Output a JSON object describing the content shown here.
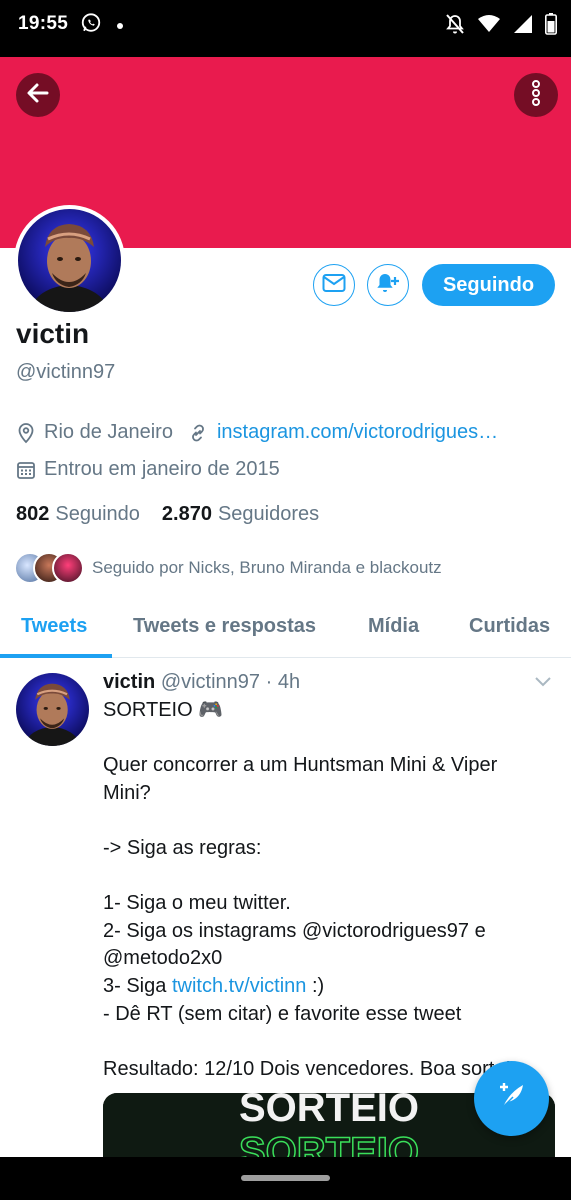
{
  "status_bar": {
    "time": "19:55",
    "icons": [
      "whatsapp-icon",
      "dot-icon",
      "notifications-off-icon",
      "wifi-icon",
      "signal-icon",
      "battery-icon"
    ]
  },
  "profile": {
    "banner_color": "#e91b4e",
    "display_name": "victin",
    "handle": "@victinn97",
    "location": "Rio de Janeiro",
    "website": "instagram.com/victorodrigues…",
    "joined": "Entrou em janeiro de 2015",
    "following_count": "802",
    "following_label": "Seguindo",
    "followers_count": "2.870",
    "followers_label": "Seguidores",
    "followed_by": "Seguido por Nicks, Bruno Miranda e blackoutz",
    "follow_button": "Seguindo"
  },
  "tabs": [
    {
      "label": "Tweets",
      "active": true
    },
    {
      "label": "Tweets e respostas",
      "active": false
    },
    {
      "label": "Mídia",
      "active": false
    },
    {
      "label": "Curtidas",
      "active": false
    }
  ],
  "tweet": {
    "name": "victin",
    "handle": "@victinn97",
    "time": "· 4h",
    "line1": "SORTEIO 🎮",
    "line2": "Quer concorrer a um Huntsman Mini & Viper Mini?",
    "line3": "-> Siga as regras:",
    "rule1": "1- Siga o meu twitter.",
    "rule2": "2- Siga os instagrams @victorodrigues97 e @metodo2x0",
    "rule3_prefix": "3- Siga ",
    "rule3_link": "twitch.tv/victinn",
    "rule3_suffix": " :)",
    "rule4": "- Dê RT (sem citar) e favorite esse tweet",
    "result": "Resultado: 12/10 Dois vencedores. Boa sorte!",
    "media_text": "SORTEIO"
  },
  "colors": {
    "accent": "#1da1f2",
    "link": "#1b95e0",
    "secondary_text": "#657786"
  }
}
